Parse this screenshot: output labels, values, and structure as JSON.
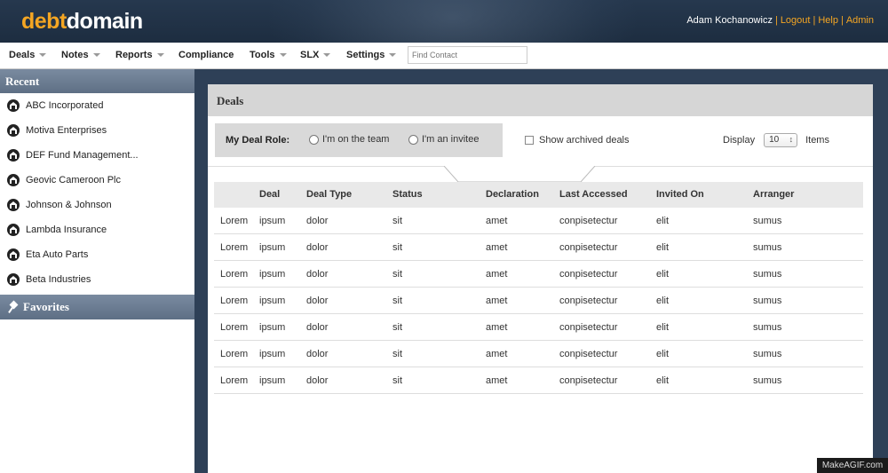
{
  "brand": {
    "part1": "debt",
    "part2": "domain"
  },
  "user": {
    "name": "Adam Kochanowicz",
    "links": [
      "Logout",
      "Help",
      "Admin"
    ]
  },
  "nav": {
    "items": [
      {
        "label": "Deals",
        "dropdown": true
      },
      {
        "label": "Notes",
        "dropdown": true
      },
      {
        "label": "Reports",
        "dropdown": true
      },
      {
        "label": "Compliance",
        "dropdown": false
      },
      {
        "label": "Tools",
        "dropdown": true
      },
      {
        "label": "SLX",
        "dropdown": true
      },
      {
        "label": "Settings",
        "dropdown": true
      }
    ],
    "find_placeholder": "Find Contact"
  },
  "sidebar": {
    "recent_title": "Recent",
    "recent": [
      "ABC Incorporated",
      "Motiva Enterprises",
      "DEF Fund Management...",
      "Geovic Cameroon Plc",
      "Johnson & Johnson",
      "Lambda Insurance",
      "Eta Auto Parts",
      "Beta Industries"
    ],
    "favorites_title": "Favorites"
  },
  "main": {
    "title": "Deals",
    "role_label": "My Deal Role:",
    "role_options": [
      "I'm on the team",
      "I'm an invitee"
    ],
    "archived_label": "Show archived deals",
    "display_label": "Display",
    "display_value": "10",
    "items_label": "Items"
  },
  "table": {
    "headers": [
      "",
      "Deal",
      "Deal Type",
      "Status",
      "Declaration",
      "Last Accessed",
      "Invited On",
      "Arranger"
    ],
    "rows": [
      [
        "Lorem",
        "ipsum",
        "dolor",
        "sit",
        "amet",
        "conpisetectur",
        "elit",
        "sumus"
      ],
      [
        "Lorem",
        "ipsum",
        "dolor",
        "sit",
        "amet",
        "conpisetectur",
        "elit",
        "sumus"
      ],
      [
        "Lorem",
        "ipsum",
        "dolor",
        "sit",
        "amet",
        "conpisetectur",
        "elit",
        "sumus"
      ],
      [
        "Lorem",
        "ipsum",
        "dolor",
        "sit",
        "amet",
        "conpisetectur",
        "elit",
        "sumus"
      ],
      [
        "Lorem",
        "ipsum",
        "dolor",
        "sit",
        "amet",
        "conpisetectur",
        "elit",
        "sumus"
      ],
      [
        "Lorem",
        "ipsum",
        "dolor",
        "sit",
        "amet",
        "conpisetectur",
        "elit",
        "sumus"
      ],
      [
        "Lorem",
        "ipsum",
        "dolor",
        "sit",
        "amet",
        "conpisetectur",
        "elit",
        "sumus"
      ]
    ]
  },
  "watermark": "MakeAGIF.com",
  "colors": {
    "accent": "#f5a623",
    "header_bg": "#1d2d40",
    "sidebar_head": "#6b7c92"
  }
}
